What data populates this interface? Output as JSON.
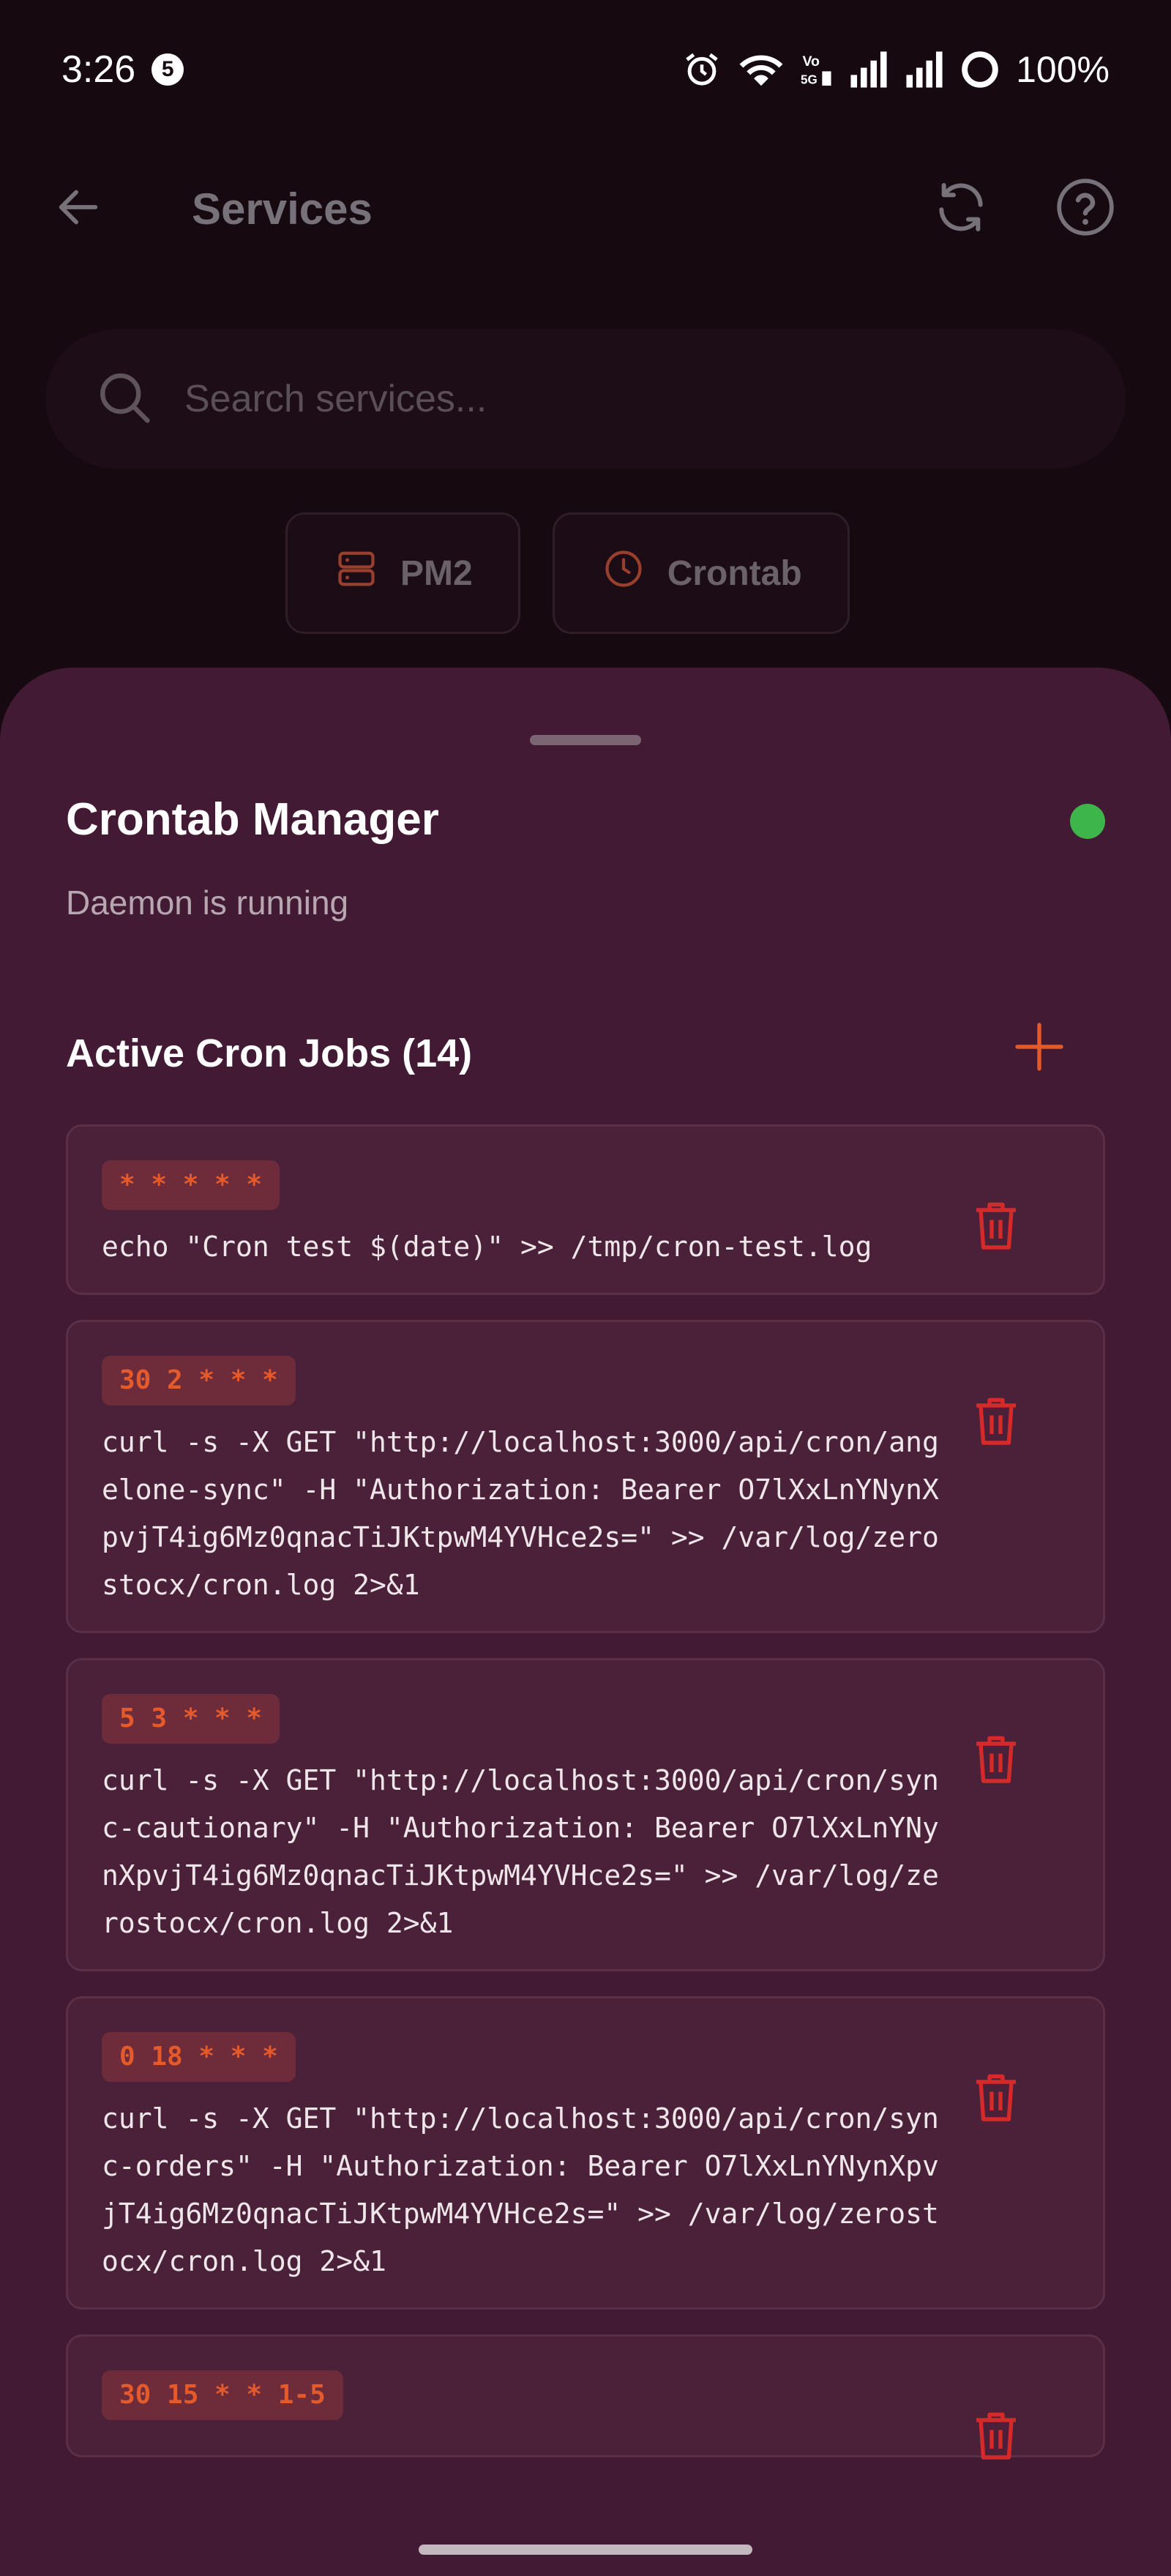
{
  "status_bar": {
    "time": "3:26",
    "notification_count": "5",
    "battery": "100%",
    "icons": [
      "alarm-icon",
      "wifi-icon",
      "volte-icon",
      "signal-icon",
      "signal-icon",
      "battery-ring-icon"
    ]
  },
  "app_bar": {
    "title": "Services",
    "back_icon": "arrow-left-icon",
    "refresh_icon": "refresh-icon",
    "help_icon": "help-circle-icon"
  },
  "search": {
    "placeholder": "Search services...",
    "value": "",
    "icon": "search-icon"
  },
  "chips": [
    {
      "label": "PM2",
      "icon": "server-icon"
    },
    {
      "label": "Crontab",
      "icon": "clock-icon"
    }
  ],
  "sheet": {
    "title": "Crontab Manager",
    "subtitle": "Daemon is running",
    "status_color": "#3db54a",
    "section_title": "Active Cron Jobs (14)",
    "add_icon": "plus-icon",
    "jobs": [
      {
        "schedule": "* * * * *",
        "command": "echo \"Cron test $(date)\" >> /tmp/cron-test.log"
      },
      {
        "schedule": "30 2 * * *",
        "command": "curl -s -X GET \"http://localhost:3000/api/cron/angelone-sync\" -H \"Authorization: Bearer O7lXxLnYNynXpvjT4ig6Mz0qnacTiJKtpwM4YVHce2s=\" >> /var/log/zerostocx/cron.log 2>&1"
      },
      {
        "schedule": "5 3 * * *",
        "command": "curl -s -X GET \"http://localhost:3000/api/cron/sync-cautionary\" -H \"Authorization: Bearer O7lXxLnYNynXpvjT4ig6Mz0qnacTiJKtpwM4YVHce2s=\" >> /var/log/zerostocx/cron.log 2>&1"
      },
      {
        "schedule": "0 18 * * *",
        "command": "curl -s -X GET \"http://localhost:3000/api/cron/sync-orders\" -H \"Authorization: Bearer O7lXxLnYNynXpvjT4ig6Mz0qnacTiJKtpwM4YVHce2s=\" >> /var/log/zerostocx/cron.log 2>&1"
      },
      {
        "schedule": "30 15 * * 1-5",
        "command": ""
      }
    ]
  },
  "colors": {
    "accent": "#e55a2b",
    "delete": "#d42a2a",
    "sheet_bg": "#431a33",
    "card_bg": "#4a2139"
  }
}
